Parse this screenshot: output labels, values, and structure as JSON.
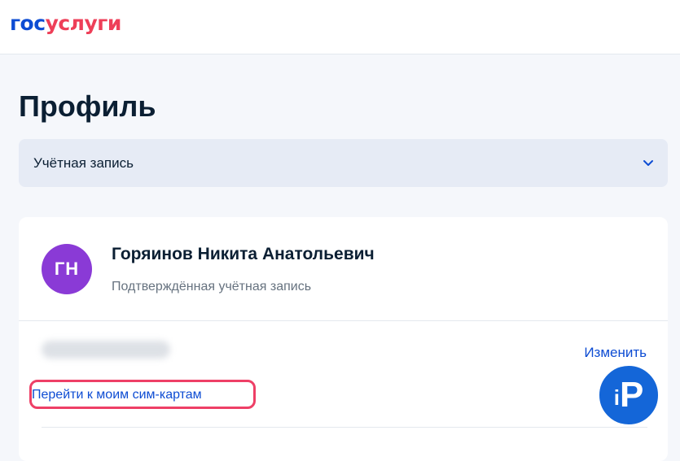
{
  "brand": {
    "logo_part1": "гос",
    "logo_part2": "услуги"
  },
  "page": {
    "title": "Профиль"
  },
  "account_select": {
    "label": "Учётная запись",
    "icon": "chevron-down-icon"
  },
  "profile": {
    "initials": "ГН",
    "name": "Горяинов Никита Анатольевич",
    "status": "Подтверждённая учётная запись",
    "edit_label": "Изменить",
    "sim_link_label": "Перейти к моим сим-картам"
  },
  "watermark": {
    "letter1": "i",
    "letter2": "P"
  },
  "colors": {
    "brand_blue": "#0d4cd3",
    "brand_red": "#ee3f58",
    "avatar_purple": "#8a3ad6",
    "highlight_red": "#ee3f66",
    "watermark_blue": "#1466d8"
  }
}
